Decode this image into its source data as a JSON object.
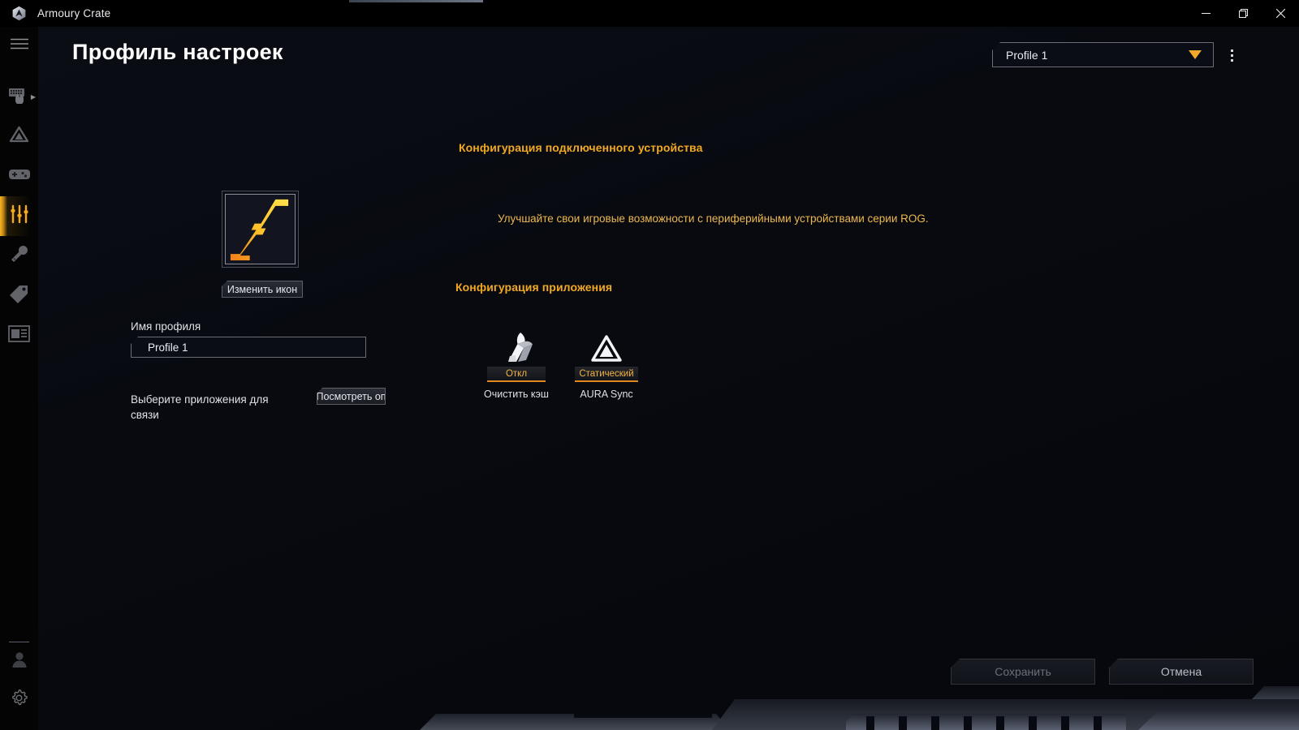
{
  "window": {
    "app_title": "Armoury Crate",
    "logo_icon": "armoury-crate-logo-icon",
    "controls": {
      "minimize": "minimize-icon",
      "restore": "restore-icon",
      "close": "close-icon"
    }
  },
  "sidebar": {
    "menu_toggle": "hamburger-menu-icon",
    "items": [
      {
        "icon": "keyboard-mouse-devices-icon",
        "name": "devices",
        "active": false,
        "has_chevron": true
      },
      {
        "icon": "aura-sync-triangle-icon",
        "name": "aura-sync",
        "active": false,
        "has_chevron": false
      },
      {
        "icon": "gamepad-game-library-icon",
        "name": "game-library",
        "active": false,
        "has_chevron": false
      },
      {
        "icon": "sliders-scenario-profiles-icon",
        "name": "scenario-profiles",
        "active": true,
        "has_chevron": false
      },
      {
        "icon": "wrench-tools-icon",
        "name": "tools",
        "active": false,
        "has_chevron": false
      },
      {
        "icon": "tag-deals-icon",
        "name": "deals",
        "active": false,
        "has_chevron": false
      },
      {
        "icon": "news-window-icon",
        "name": "news",
        "active": false,
        "has_chevron": false
      }
    ],
    "bottom_items": [
      {
        "icon": "user-account-icon",
        "name": "user-account"
      },
      {
        "icon": "gear-settings-icon",
        "name": "settings"
      }
    ]
  },
  "header": {
    "title": "Профиль настроек",
    "ghost_title": "Профиль настроек",
    "profile_selector": {
      "value": "Profile 1",
      "caret_icon": "chevron-down-icon"
    },
    "overflow_menu": "kebab-menu-icon"
  },
  "left_panel": {
    "profile_icon": {
      "name": "profile-lightning-icon",
      "gradient_from": "#ffe14a",
      "gradient_to": "#f07f18"
    },
    "change_icon_button": "Изменить икон",
    "profile_name_label": "Имя профиля",
    "profile_name_value": "Profile 1",
    "profile_name_placeholder": "Profile 1",
    "link_apps_label": "Выберите приложения для связи",
    "view_apps_button": "Посмотреть оп"
  },
  "right_panel": {
    "device_section_title": "Конфигурация подключенного устройства",
    "device_description": "Улучшайте свои игровые возможности с периферийными устройствами серии ROG.",
    "app_section_title": "Конфигурация приложения",
    "tiles": [
      {
        "icon": "broom-clear-cache-icon",
        "status": "Откл",
        "label": "Очистить кэш",
        "wide": false
      },
      {
        "icon": "aura-sync-triangle-icon",
        "status": "Статический",
        "label": "AURA Sync",
        "wide": true
      }
    ]
  },
  "footer": {
    "save_button": "Сохранить",
    "save_enabled": false,
    "cancel_button": "Отмена",
    "cancel_enabled": true
  },
  "colors": {
    "accent_orange": "#f2a922",
    "accent_amber": "#f0a92a",
    "text_primary": "#e7eaef",
    "background": "#060910"
  }
}
